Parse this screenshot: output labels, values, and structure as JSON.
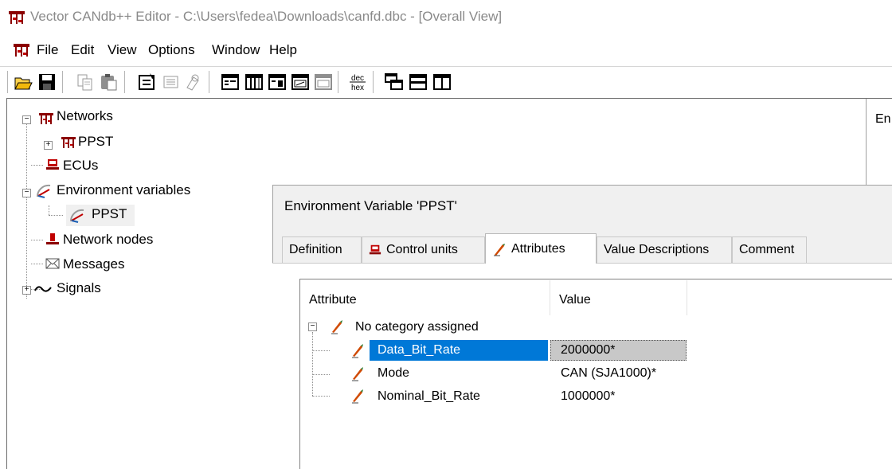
{
  "window": {
    "title": "Vector CANdb++ Editor - C:\\Users\\fedea\\Downloads\\canfd.dbc - [Overall View]"
  },
  "menu": [
    "File",
    "Edit",
    "View",
    "Options",
    "Window",
    "Help"
  ],
  "toolbar": {
    "buttons": [
      "open-icon",
      "save-icon",
      "copy-icon",
      "paste-icon",
      "properties-icon",
      "list-icon",
      "find-icon",
      "view1-icon",
      "view2-icon",
      "view3-icon",
      "view4-icon",
      "view5-icon",
      "dec-hex-icon",
      "arrange-icon",
      "tile-horizontal-icon",
      "tile-vertical-icon"
    ],
    "dec_label": "dec",
    "hex_label": "hex"
  },
  "tree": {
    "networks": "Networks",
    "network_ppst": "PPST",
    "ecus": "ECUs",
    "env_vars": "Environment variables",
    "env_ppst": "PPST",
    "network_nodes": "Network nodes",
    "messages": "Messages",
    "signals": "Signals"
  },
  "right_panel": {
    "label": "En"
  },
  "dialog": {
    "title": "Environment Variable 'PPST'",
    "tabs": [
      "Definition",
      "Control units",
      "Attributes",
      "Value Descriptions",
      "Comment"
    ],
    "active_tab": "Attributes",
    "columns": [
      "Attribute",
      "Value"
    ],
    "category": "No category assigned",
    "rows": [
      {
        "attribute": "Data_Bit_Rate",
        "value": "2000000*",
        "selected": true
      },
      {
        "attribute": "Mode",
        "value": "CAN (SJA1000)*",
        "selected": false
      },
      {
        "attribute": "Nominal_Bit_Rate",
        "value": "1000000*",
        "selected": false
      }
    ]
  },
  "colors": {
    "selection": "#0078d7",
    "value_highlight": "#c8c8c8",
    "title_text": "#8a8a8a"
  }
}
